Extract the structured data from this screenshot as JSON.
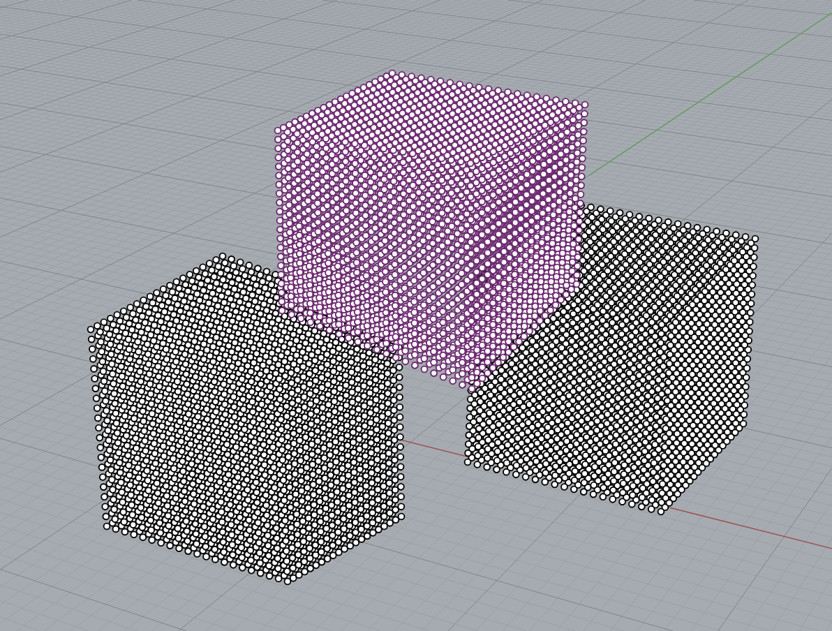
{
  "viewport": {
    "objects": [
      {
        "selected": false
      },
      {
        "selected": true
      },
      {
        "selected": false
      }
    ]
  }
}
